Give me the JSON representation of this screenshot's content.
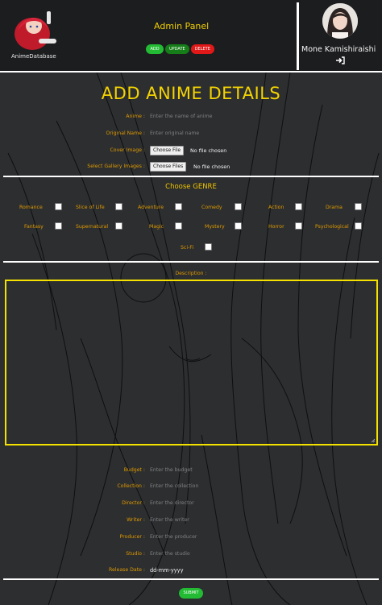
{
  "header": {
    "logo_text": "AnimeDatabase",
    "title": "Admin Panel",
    "buttons": {
      "add": "ADD",
      "update": "UPDATE",
      "delete": "DELETE"
    },
    "user_name": "Mone Kamishiraishi",
    "icons": {
      "logo": "anime-logo-icon",
      "avatar": "user-avatar",
      "logout": "logout-icon"
    }
  },
  "form": {
    "title": "ADD ANIME DETAILS",
    "anime_label": "Anime :",
    "anime_placeholder": "Enter the name of anime",
    "original_label": "Original Name :",
    "original_placeholder": "Enter original name",
    "cover_label": "Cover Image :",
    "cover_button": "Choose File",
    "cover_status": "No file chosen",
    "gallery_label": "Select Gallery Images :",
    "gallery_button": "Choose Files",
    "gallery_status": "No file chosen",
    "genre_title": "Choose GENRE",
    "genres": [
      "Romance",
      "Slice of Life",
      "Adventure",
      "Comedy",
      "Action",
      "Drama",
      "Fantasy",
      "Supernatural",
      "Magic",
      "Mystery",
      "Horror",
      "Psychological",
      "Sci-Fi"
    ],
    "description_label": "Description :",
    "budget_label": "Budget :",
    "budget_placeholder": "Enter the budget",
    "collection_label": "Collection :",
    "collection_placeholder": "Enter the collection",
    "director_label": "Director :",
    "director_placeholder": "Enter the director",
    "writer_label": "Writer :",
    "writer_placeholder": "Enter the writer",
    "producer_label": "Producer :",
    "producer_placeholder": "Enter the producer",
    "studio_label": "Studio :",
    "studio_placeholder": "Enter the studio",
    "release_label": "Release Date :",
    "release_value": "dd-mm-yyyy",
    "submit": "SUBMIT"
  },
  "colors": {
    "background": "#2c2e30",
    "header": "#1c1d1f",
    "label": "#e09a00",
    "title": "#f5d400",
    "accent_green": "#22bb33",
    "dark_green": "#157e18",
    "red": "#e01818",
    "textarea_border": "#f5e100"
  }
}
